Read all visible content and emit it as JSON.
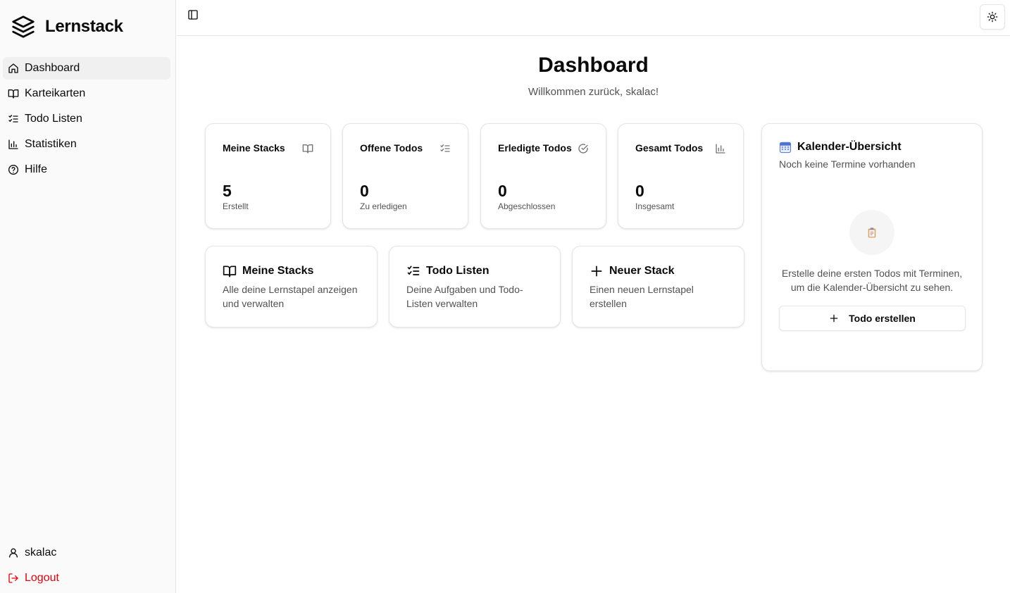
{
  "app": {
    "name": "Lernstack",
    "logo_icon": "layers-icon"
  },
  "sidebar": {
    "items": [
      {
        "label": "Dashboard",
        "icon": "home-icon",
        "active": true
      },
      {
        "label": "Karteikarten",
        "icon": "book-open-icon",
        "active": false
      },
      {
        "label": "Todo Listen",
        "icon": "list-checks-icon",
        "active": false
      },
      {
        "label": "Statistiken",
        "icon": "bar-chart-icon",
        "active": false
      },
      {
        "label": "Hilfe",
        "icon": "help-circle-icon",
        "active": false
      }
    ],
    "user": {
      "label": "skalac",
      "icon": "user-icon"
    },
    "logout": {
      "label": "Logout",
      "icon": "logout-icon",
      "color": "#e7000b"
    }
  },
  "header": {
    "sidebar_toggle_icon": "panel-left-icon",
    "theme_icon": "sun-icon"
  },
  "main": {
    "title": "Dashboard",
    "subtitle": "Willkommen zurück, skalac!",
    "stats": [
      {
        "title": "Meine Stacks",
        "value": "5",
        "caption": "Erstellt",
        "icon": "book-open-icon"
      },
      {
        "title": "Offene Todos",
        "value": "0",
        "caption": "Zu erledigen",
        "icon": "list-checks-icon"
      },
      {
        "title": "Erledigte Todos",
        "value": "0",
        "caption": "Abgeschlossen",
        "icon": "check-circle-icon"
      },
      {
        "title": "Gesamt Todos",
        "value": "0",
        "caption": "Insgesamt",
        "icon": "bar-chart-icon"
      }
    ],
    "actions": [
      {
        "title": "Meine Stacks",
        "description": "Alle deine Lernstapel anzeigen und verwalten",
        "icon": "book-open-icon"
      },
      {
        "title": "Todo Listen",
        "description": "Deine Aufgaben und Todo-Listen verwalten",
        "icon": "list-checks-icon"
      },
      {
        "title": "Neuer Stack",
        "description": "Einen neuen Lernstapel erstellen",
        "icon": "plus-icon"
      }
    ],
    "calendar": {
      "title": "Kalender-Übersicht",
      "icon": "calendar-icon",
      "subtitle": "Noch keine Termine vorhanden",
      "empty_icon": "clipboard-icon",
      "empty_text": "Erstelle deine ersten Todos mit Terminen, um die Kalender-Übersicht zu sehen.",
      "button_label": "Todo erstellen"
    }
  }
}
